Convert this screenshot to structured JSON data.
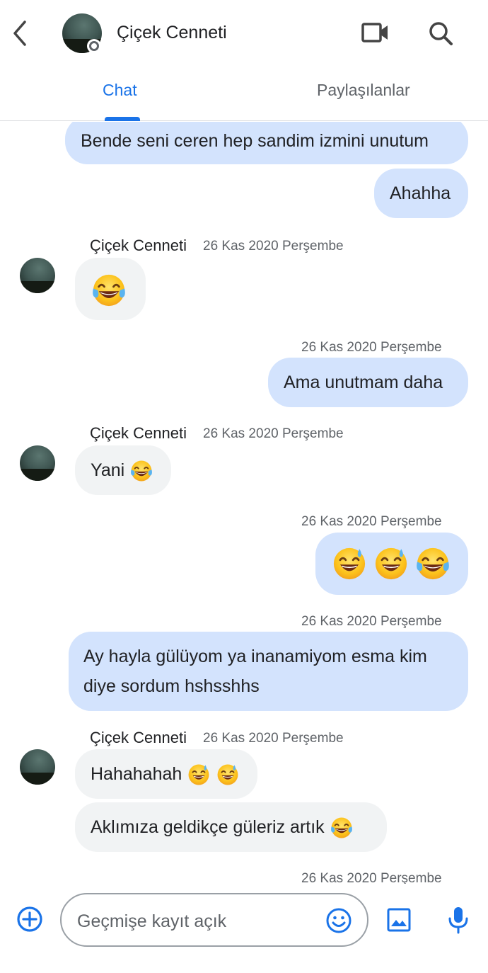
{
  "header": {
    "title": "Çiçek Cenneti",
    "back_icon": "chevron-left-icon",
    "video_icon": "video-camera-icon",
    "search_icon": "search-icon"
  },
  "tabs": [
    {
      "label": "Chat",
      "active": true
    },
    {
      "label": "Paylaşılanlar",
      "active": false
    }
  ],
  "colors": {
    "accent": "#1a73e8",
    "outgoing_bubble": "#d3e3fd",
    "incoming_bubble": "#f1f3f4",
    "meta_text": "#5f6368"
  },
  "messages": {
    "m1": {
      "text": "Bende seni ceren hep sandim izmini unutum"
    },
    "m2": {
      "text": "Ahahha"
    },
    "g1": {
      "sender": "Çiçek Cenneti",
      "time": "26 Kas 2020 Perşembe"
    },
    "m3": {
      "emoji": [
        "joy"
      ]
    },
    "t1": {
      "time": "26 Kas 2020 Perşembe"
    },
    "m4": {
      "text": "Ama unutmam daha"
    },
    "g2": {
      "sender": "Çiçek Cenneti",
      "time": "26 Kas 2020 Perşembe"
    },
    "m5": {
      "text": "Yani",
      "emoji": [
        "joy"
      ]
    },
    "t2": {
      "time": "26 Kas 2020 Perşembe"
    },
    "m6": {
      "emoji": [
        "sweat-smile",
        "sweat-smile",
        "joy"
      ]
    },
    "t3": {
      "time": "26 Kas 2020 Perşembe"
    },
    "m7": {
      "line1": "Ay hayla gülüyom ya inanamiyom esma kim",
      "line2": "diye sordum hshsshhs"
    },
    "g3": {
      "sender": "Çiçek Cenneti",
      "time": "26 Kas 2020 Perşembe"
    },
    "m8": {
      "text": "Hahahahah",
      "emoji": [
        "sweat-smile",
        "sweat-smile"
      ]
    },
    "m9": {
      "text": "Aklımıza geldikçe güleriz artık",
      "emoji": [
        "joy"
      ]
    },
    "t4": {
      "time": "26 Kas 2020 Perşembe"
    }
  },
  "composer": {
    "placeholder": "Geçmişe kayıt açık",
    "add_icon": "add-circle-icon",
    "emoji_icon": "emoji-smiley-icon",
    "image_icon": "image-icon",
    "mic_icon": "microphone-icon"
  }
}
